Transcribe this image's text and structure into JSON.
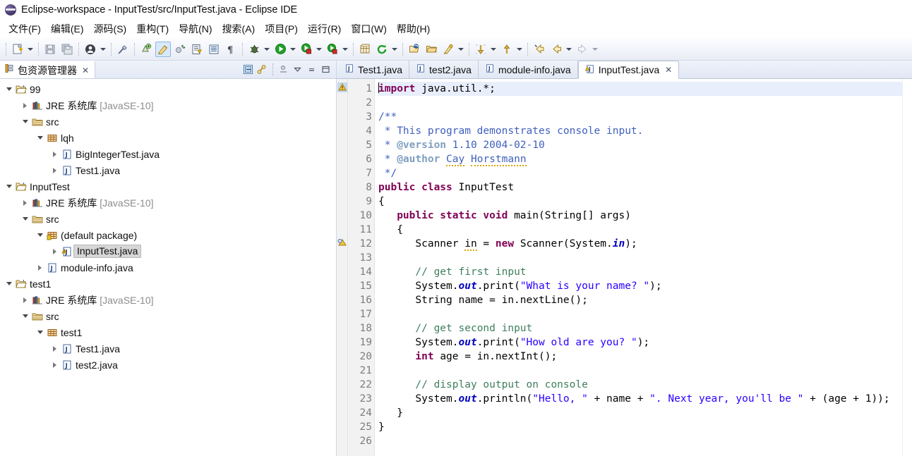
{
  "window": {
    "title": "Eclipse-workspace - InputTest/src/InputTest.java - Eclipse IDE",
    "app_icon": "eclipse-icon"
  },
  "menubar": {
    "items": [
      {
        "label": "文件(F)",
        "name": "menu-file"
      },
      {
        "label": "编辑(E)",
        "name": "menu-edit"
      },
      {
        "label": "源码(S)",
        "name": "menu-source"
      },
      {
        "label": "重构(T)",
        "name": "menu-refactor"
      },
      {
        "label": "导航(N)",
        "name": "menu-navigate"
      },
      {
        "label": "搜索(A)",
        "name": "menu-search"
      },
      {
        "label": "项目(P)",
        "name": "menu-project"
      },
      {
        "label": "运行(R)",
        "name": "menu-run"
      },
      {
        "label": "窗口(W)",
        "name": "menu-window"
      },
      {
        "label": "帮助(H)",
        "name": "menu-help"
      }
    ]
  },
  "toolbar": {
    "groups": [
      [
        "new-wizard-icon",
        "dropdown-caret",
        "save-icon",
        "save-all-icon"
      ],
      [
        "user-account-icon",
        "dropdown-caret"
      ],
      [
        "link-break-icon"
      ],
      [
        "new-java-package-icon",
        "toggle-markoccurrences-icon",
        "skip-breakpoints-icon",
        "open-task-icon",
        "open-console-icon",
        "pilcrow-icon"
      ],
      [
        "debug-icon",
        "dropdown-caret",
        "run-icon",
        "dropdown-caret",
        "coverage-icon",
        "dropdown-caret"
      ],
      [
        "new-java-project-icon",
        "refresh-icon",
        "dropdown-caret"
      ],
      [
        "open-type-icon",
        "open-resource-icon",
        "search-pencil-icon",
        "dropdown-caret"
      ],
      [
        "next-annotation-icon",
        "dropdown-caret",
        "previous-annotation-icon",
        "dropdown-caret"
      ],
      [
        "back-history-icon",
        "back-icon",
        "dropdown-caret",
        "forward-icon",
        "dropdown-caret"
      ]
    ]
  },
  "package_explorer": {
    "tab_label": "包资源管理器",
    "tab_close": "✕",
    "tab_icon": "package-explorer-icon",
    "tools": [
      {
        "name": "collapse-all-icon",
        "glyph": "collapse-all"
      },
      {
        "name": "link-with-editor-icon",
        "glyph": "link"
      },
      {
        "name": "view-menu-icon",
        "glyph": "view-menu"
      },
      {
        "name": "minimize-view-icon",
        "glyph": "minimize"
      },
      {
        "name": "maximize-view-icon",
        "glyph": "maximize"
      }
    ],
    "tree": [
      {
        "label": "99",
        "icon": "java-project-icon",
        "indent": 0,
        "twisty": "down",
        "selected": false
      },
      {
        "label": "JRE 系统库",
        "suffix": " [JavaSE-10]",
        "icon": "jre-library-icon",
        "indent": 1,
        "twisty": "right",
        "selected": false
      },
      {
        "label": "src",
        "icon": "source-folder-icon",
        "indent": 1,
        "twisty": "down",
        "selected": false
      },
      {
        "label": "lqh",
        "icon": "package-icon",
        "indent": 2,
        "twisty": "down",
        "selected": false
      },
      {
        "label": "BigIntegerTest.java",
        "icon": "java-file-icon",
        "indent": 3,
        "twisty": "right",
        "selected": false
      },
      {
        "label": "Test1.java",
        "icon": "java-file-icon",
        "indent": 3,
        "twisty": "right",
        "selected": false
      },
      {
        "label": "InputTest",
        "icon": "java-project-icon",
        "indent": 0,
        "twisty": "down",
        "selected": false
      },
      {
        "label": "JRE 系统库",
        "suffix": " [JavaSE-10]",
        "icon": "jre-library-icon",
        "indent": 1,
        "twisty": "right",
        "selected": false
      },
      {
        "label": "src",
        "icon": "source-folder-icon",
        "indent": 1,
        "twisty": "down",
        "selected": false
      },
      {
        "label": "(default package)",
        "icon": "default-package-icon",
        "indent": 2,
        "twisty": "down",
        "selected": false
      },
      {
        "label": "InputTest.java",
        "icon": "java-file-warning-icon",
        "indent": 3,
        "twisty": "right",
        "selected": true
      },
      {
        "label": "module-info.java",
        "icon": "java-file-icon",
        "indent": 2,
        "twisty": "right",
        "selected": false
      },
      {
        "label": "test1",
        "icon": "java-project-icon",
        "indent": 0,
        "twisty": "down",
        "selected": false
      },
      {
        "label": "JRE 系统库",
        "suffix": " [JavaSE-10]",
        "icon": "jre-library-icon",
        "indent": 1,
        "twisty": "right",
        "selected": false
      },
      {
        "label": "src",
        "icon": "source-folder-icon",
        "indent": 1,
        "twisty": "down",
        "selected": false
      },
      {
        "label": "test1",
        "icon": "package-icon",
        "indent": 2,
        "twisty": "down",
        "selected": false
      },
      {
        "label": "Test1.java",
        "icon": "java-file-icon",
        "indent": 3,
        "twisty": "right",
        "selected": false
      },
      {
        "label": "test2.java",
        "icon": "java-file-icon",
        "indent": 3,
        "twisty": "right",
        "selected": false
      }
    ]
  },
  "editor": {
    "tabs": [
      {
        "label": "Test1.java",
        "icon": "java-file-icon",
        "active": false,
        "closable": false
      },
      {
        "label": "test2.java",
        "icon": "java-file-icon",
        "active": false,
        "closable": false
      },
      {
        "label": "module-info.java",
        "icon": "java-file-icon",
        "active": false,
        "closable": false
      },
      {
        "label": "InputTest.java",
        "icon": "java-file-warning-icon",
        "active": true,
        "closable": true,
        "close": "✕"
      }
    ],
    "gutter": {
      "lines": [
        "1",
        "2",
        "3",
        "4",
        "5",
        "6",
        "7",
        "8",
        "9",
        "10",
        "11",
        "12",
        "13",
        "14",
        "15",
        "16",
        "17",
        "18",
        "19",
        "20",
        "21",
        "22",
        "23",
        "24",
        "25",
        "26"
      ],
      "fold_lines": [
        "3",
        "10"
      ],
      "warning_lines": [
        "1",
        "12"
      ]
    },
    "code": [
      "import java.util.*;",
      "",
      "/**",
      " * This program demonstrates console input.",
      " * @version 1.10 2004-02-10",
      " * @author Cay Horstmann",
      " */",
      "public class InputTest",
      "{",
      "   public static void main(String[] args)",
      "   {",
      "      Scanner in = new Scanner(System.in);",
      "",
      "      // get first input",
      "      System.out.print(\"What is your name? \");",
      "      String name = in.nextLine();",
      "",
      "      // get second input",
      "      System.out.print(\"How old are you? \");",
      "      int age = in.nextInt();",
      "",
      "      // display output on console",
      "      System.out.println(\"Hello, \" + name + \". Next year, you'll be \" + (age + 1));",
      "   }",
      "}",
      ""
    ],
    "colors": {
      "keyword": "#7f0055",
      "string": "#2a00ff",
      "comment": "#3f7f5f",
      "javadoc": "#3f5fbf",
      "javadoc_tag": "#7f9fbf",
      "field": "#0000c0",
      "current_line": "#e8eefb",
      "gutter_bg": "#f2f2f2"
    }
  }
}
